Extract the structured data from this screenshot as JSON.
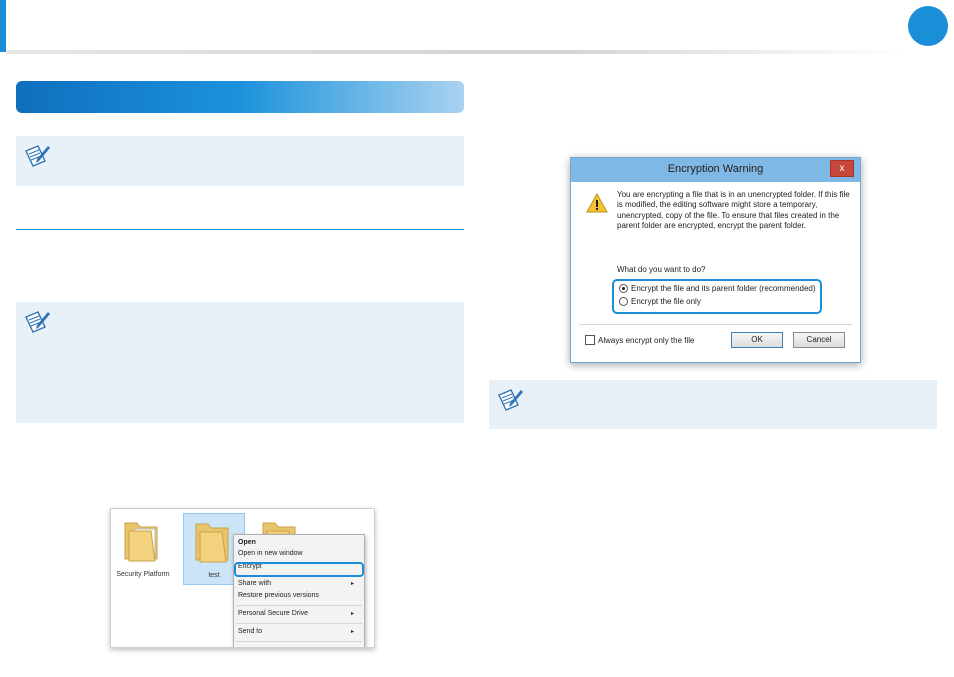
{
  "dialog": {
    "title": "Encryption Warning",
    "close_glyph": "x",
    "message": "You are encrypting a file that is in an unencrypted folder. If this file is modified, the editing software might store a temporary, unencrypted, copy of the file. To ensure that files created in the parent folder are encrypted, encrypt the parent folder.",
    "question": "What do you want to do?",
    "options": [
      {
        "label": "Encrypt the file and its parent folder (recommended)",
        "selected": true
      },
      {
        "label": "Encrypt the file only",
        "selected": false
      }
    ],
    "checkbox_label": "Always encrypt only the file",
    "ok_label": "OK",
    "cancel_label": "Cancel"
  },
  "explorer": {
    "folders": [
      {
        "label": "Security Platform",
        "selected": false
      },
      {
        "label": "test",
        "selected": true
      },
      {
        "label": "",
        "selected": false
      }
    ],
    "context_menu": [
      {
        "label": "Open",
        "bold": true,
        "submenu": false
      },
      {
        "label": "Open in new window",
        "bold": false,
        "submenu": false
      },
      {
        "label": "Encrypt",
        "bold": false,
        "submenu": false,
        "highlighted": true
      },
      {
        "label": "Share with",
        "bold": false,
        "submenu": true
      },
      {
        "label": "Restore previous versions",
        "bold": false,
        "submenu": false
      },
      {
        "label": "Personal Secure Drive",
        "bold": false,
        "submenu": true
      },
      {
        "label": "Send to",
        "bold": false,
        "submenu": true
      }
    ],
    "submenu_arrow": "▸"
  },
  "colors": {
    "accent": "#1a8fd8",
    "note_bg": "#e8f0f8",
    "dialog_title_bar": "#7fb7e5"
  },
  "icons": [
    "note-pencil-icon",
    "warning-icon",
    "folder-icon",
    "close-icon"
  ]
}
